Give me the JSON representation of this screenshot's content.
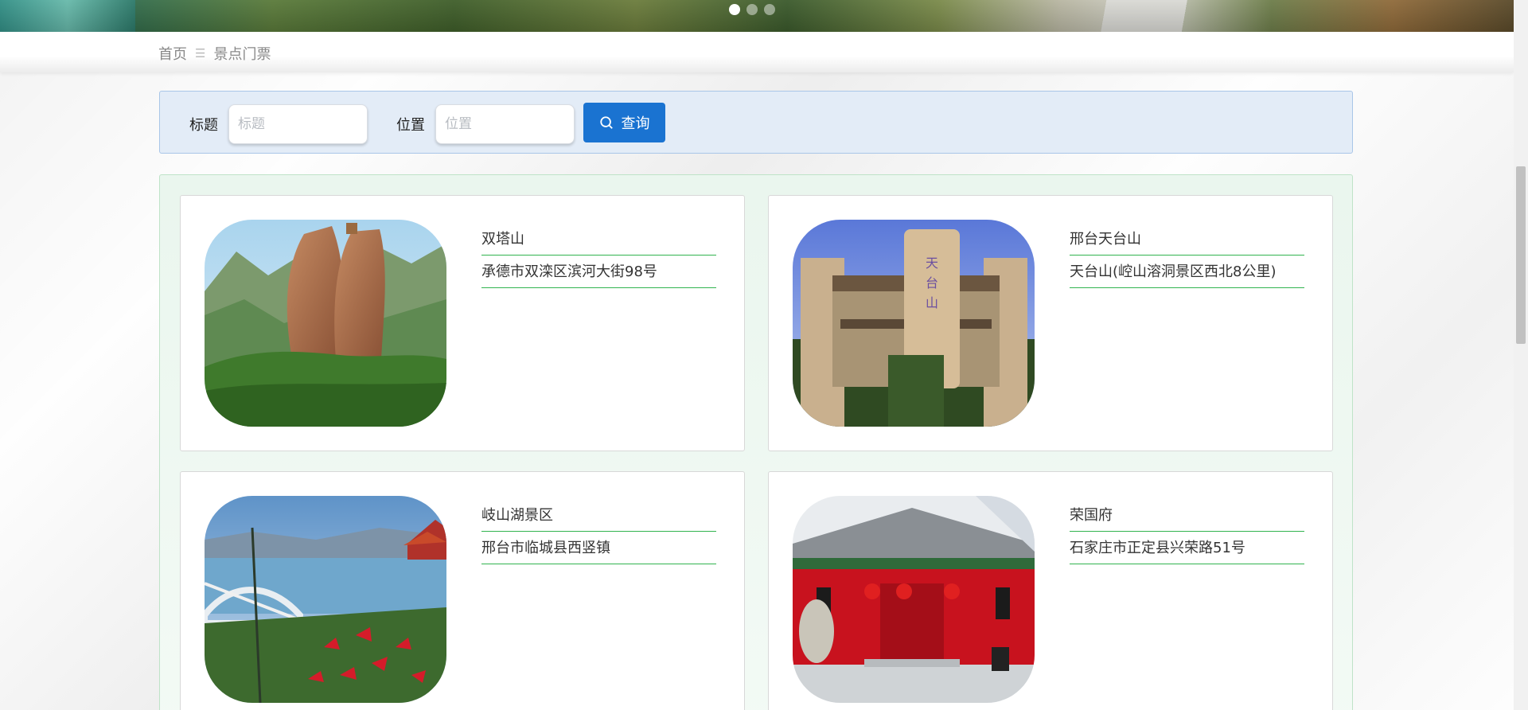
{
  "banner": {
    "slide_count": 3,
    "active_slide": 1
  },
  "breadcrumb": {
    "home": "首页",
    "separator": "☰",
    "current": "景点门票"
  },
  "search": {
    "title_label": "标题",
    "title_placeholder": "标题",
    "title_value": "",
    "location_label": "位置",
    "location_placeholder": "位置",
    "location_value": "",
    "query_button": "查询"
  },
  "spots": [
    {
      "name": "双塔山",
      "address": "承德市双滦区滨河大街98号",
      "image": "red-rock-twin-peaks"
    },
    {
      "name": "邢台天台山",
      "address": "天台山(崆山溶洞景区西北8公里)",
      "image": "stone-gate-tower"
    },
    {
      "name": "岐山湖景区",
      "address": "邢台市临城县西竖镇",
      "image": "lake-bridge-pavilion"
    },
    {
      "name": "荣国府",
      "address": "石家庄市正定县兴荣路51号",
      "image": "red-mansion-gate"
    }
  ],
  "colors": {
    "accent_blue": "#1a73d1",
    "underline_green": "#32b44f",
    "search_bg": "#e3ecf7",
    "results_bg": "#eaf6ee"
  }
}
